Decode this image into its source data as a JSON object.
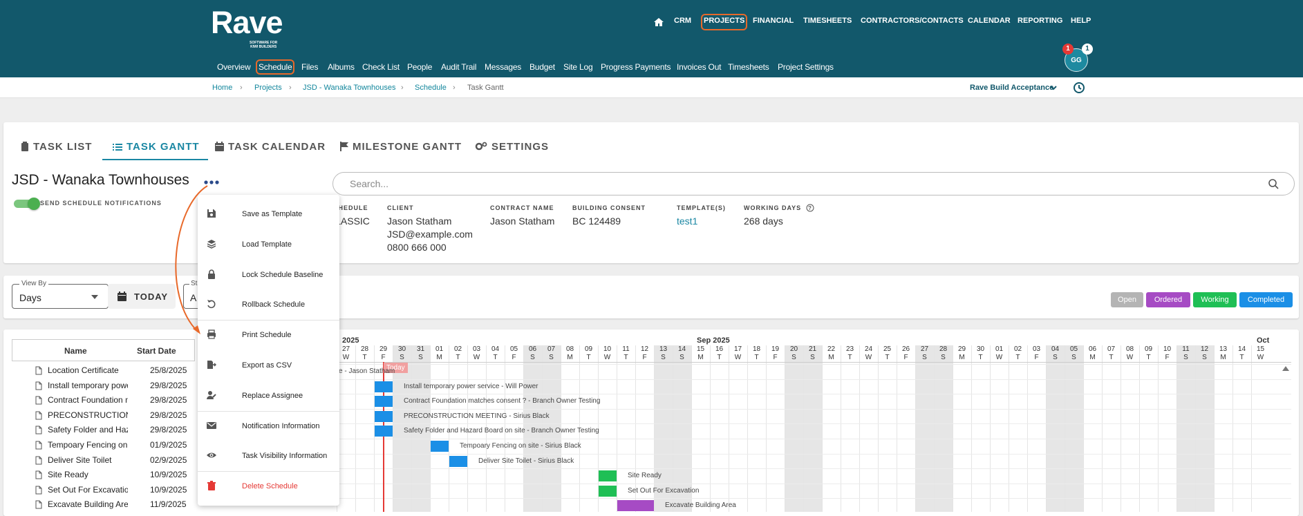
{
  "brand": {
    "name": "Rave",
    "tagline": "SOFTWARE FOR\nKIWI BUILDERS"
  },
  "top_nav": [
    "CRM",
    "PROJECTS",
    "FINANCIAL",
    "TIMESHEETS",
    "CONTRACTORS/CONTACTS",
    "CALENDAR",
    "REPORTING",
    "HELP"
  ],
  "sub_nav": [
    "Overview",
    "Schedule",
    "Files",
    "Albums",
    "Check List",
    "People",
    "Audit Trail",
    "Messages",
    "Budget",
    "Site Log",
    "Progress Payments",
    "Invoices Out",
    "Timesheets",
    "Project Settings"
  ],
  "avatar": {
    "initials": "GG",
    "badge_red": "1",
    "badge_white": "1"
  },
  "breadcrumb": [
    "Home",
    "Projects",
    "JSD - Wanaka Townhouses",
    "Schedule",
    "Task Gantt"
  ],
  "org_selector": "Rave Build Acceptance",
  "tabs": [
    "TASK LIST",
    "TASK GANTT",
    "TASK CALENDAR",
    "MILESTONE GANTT",
    "SETTINGS"
  ],
  "project": {
    "title": "JSD - Wanaka Townhouses",
    "notify_label": "SEND SCHEDULE NOTIFICATIONS",
    "search_placeholder": "Search..."
  },
  "info": {
    "schedule_label": "SCHEDULE",
    "schedule": "CLASSIC",
    "client_label": "CLIENT",
    "client_name": "Jason Statham",
    "client_email": "JSD@example.com",
    "client_phone": "0800 666 000",
    "contract_label": "CONTRACT NAME",
    "contract": "Jason Statham",
    "consent_label": "BUILDING CONSENT",
    "consent": "BC 124489",
    "template_label": "TEMPLATE(S)",
    "template": "test1",
    "wd_label": "WORKING DAYS",
    "wd": "268 days"
  },
  "controls": {
    "view_by_label": "View By",
    "view_by": "Days",
    "today": "TODAY",
    "s_label": "St",
    "s_value": "A"
  },
  "legend": [
    {
      "label": "Open",
      "color": "#b4b4b4"
    },
    {
      "label": "Ordered",
      "color": "#a64bc4"
    },
    {
      "label": "Working",
      "color": "#1fbf55"
    },
    {
      "label": "Completed",
      "color": "#1b8fe6"
    }
  ],
  "grid": {
    "col_name": "Name",
    "col_start": "Start Date",
    "rows": [
      {
        "name": "Location Certificate",
        "start": "25/8/2025"
      },
      {
        "name": "Install temporary power s",
        "start": "29/8/2025"
      },
      {
        "name": "Contract Foundation mate",
        "start": "29/8/2025"
      },
      {
        "name": "PRECONSTRUCTION M",
        "start": "29/8/2025"
      },
      {
        "name": "Safety Folder and Hazarc",
        "start": "29/8/2025"
      },
      {
        "name": "Tempoary Fencing on site",
        "start": "01/9/2025"
      },
      {
        "name": "Deliver Site Toilet",
        "start": "02/9/2025"
      },
      {
        "name": "Site Ready",
        "start": "10/9/2025"
      },
      {
        "name": "Set Out For Excavation",
        "start": "10/9/2025"
      },
      {
        "name": "Excavate Building Area",
        "start": "11/9/2025"
      }
    ]
  },
  "timeline": {
    "months": [
      {
        "label": "2025",
        "day_index": 0
      },
      {
        "label": "Sep 2025",
        "day_index": 19
      },
      {
        "label": "Oct",
        "day_index": 49
      }
    ],
    "days": [
      {
        "d": "27",
        "w": "W"
      },
      {
        "d": "28",
        "w": "T"
      },
      {
        "d": "29",
        "w": "F"
      },
      {
        "d": "30",
        "w": "S"
      },
      {
        "d": "31",
        "w": "S"
      },
      {
        "d": "01",
        "w": "M"
      },
      {
        "d": "02",
        "w": "T"
      },
      {
        "d": "03",
        "w": "W"
      },
      {
        "d": "04",
        "w": "T"
      },
      {
        "d": "05",
        "w": "F"
      },
      {
        "d": "06",
        "w": "S"
      },
      {
        "d": "07",
        "w": "S"
      },
      {
        "d": "08",
        "w": "M"
      },
      {
        "d": "09",
        "w": "T"
      },
      {
        "d": "10",
        "w": "W"
      },
      {
        "d": "11",
        "w": "T"
      },
      {
        "d": "12",
        "w": "F"
      },
      {
        "d": "13",
        "w": "S"
      },
      {
        "d": "14",
        "w": "S"
      },
      {
        "d": "15",
        "w": "M"
      },
      {
        "d": "16",
        "w": "T"
      },
      {
        "d": "17",
        "w": "W"
      },
      {
        "d": "18",
        "w": "T"
      },
      {
        "d": "19",
        "w": "F"
      },
      {
        "d": "20",
        "w": "S"
      },
      {
        "d": "21",
        "w": "S"
      },
      {
        "d": "22",
        "w": "M"
      },
      {
        "d": "23",
        "w": "T"
      },
      {
        "d": "24",
        "w": "W"
      },
      {
        "d": "25",
        "w": "T"
      },
      {
        "d": "26",
        "w": "F"
      },
      {
        "d": "27",
        "w": "S"
      },
      {
        "d": "28",
        "w": "S"
      },
      {
        "d": "29",
        "w": "M"
      },
      {
        "d": "30",
        "w": "T"
      },
      {
        "d": "01",
        "w": "W"
      },
      {
        "d": "02",
        "w": "T"
      },
      {
        "d": "03",
        "w": "F"
      },
      {
        "d": "04",
        "w": "S"
      },
      {
        "d": "05",
        "w": "S"
      },
      {
        "d": "06",
        "w": "M"
      },
      {
        "d": "07",
        "w": "T"
      },
      {
        "d": "08",
        "w": "W"
      },
      {
        "d": "09",
        "w": "T"
      },
      {
        "d": "10",
        "w": "F"
      },
      {
        "d": "11",
        "w": "S"
      },
      {
        "d": "12",
        "w": "S"
      },
      {
        "d": "13",
        "w": "M"
      },
      {
        "d": "14",
        "w": "T"
      },
      {
        "d": "15",
        "w": "W"
      }
    ],
    "today_label": "Today",
    "today_index": 2,
    "bars": [
      {
        "label": "Location Certificate - Jason Statham",
        "start": -4,
        "len": 1,
        "color": "#1b8fe6"
      },
      {
        "label": "Install temporary power service - Will Power",
        "start": 2,
        "len": 1,
        "color": "#1b8fe6"
      },
      {
        "label": "Contract Foundation matches consent ? - Branch Owner Testing",
        "start": 2,
        "len": 1,
        "color": "#1b8fe6"
      },
      {
        "label": "PRECONSTRUCTION MEETING - Sirius Black",
        "start": 2,
        "len": 1,
        "color": "#1b8fe6"
      },
      {
        "label": "Safety Folder and Hazard Board on site - Branch Owner Testing",
        "start": 2,
        "len": 1,
        "color": "#1b8fe6"
      },
      {
        "label": "Tempoary Fencing on site - Sirius Black",
        "start": 5,
        "len": 1,
        "color": "#1b8fe6"
      },
      {
        "label": "Deliver Site Toilet - Sirius Black",
        "start": 6,
        "len": 1,
        "color": "#1b8fe6"
      },
      {
        "label": "Site Ready",
        "start": 14,
        "len": 1,
        "color": "#1fbf55"
      },
      {
        "label": "Set Out For Excavation",
        "start": 14,
        "len": 1,
        "color": "#1fbf55"
      },
      {
        "label": "Excavate Building Area",
        "start": 15,
        "len": 2,
        "color": "#a64bc4"
      }
    ]
  },
  "menu": [
    {
      "label": "Save as Template",
      "icon": "save-icon"
    },
    {
      "label": "Load Template",
      "icon": "layers-icon"
    },
    {
      "label": "Lock Schedule Baseline",
      "icon": "lock-icon"
    },
    {
      "label": "Rollback Schedule",
      "icon": "rollback-icon"
    },
    {
      "label": "Print Schedule",
      "icon": "print-icon"
    },
    {
      "label": "Export as CSV",
      "icon": "export-icon"
    },
    {
      "label": "Replace Assignee",
      "icon": "replace-assignee-icon"
    },
    {
      "label": "Notification Information",
      "icon": "mail-icon"
    },
    {
      "label": "Task Visibility Information",
      "icon": "eye-icon"
    },
    {
      "label": "Delete Schedule",
      "icon": "trash-icon"
    }
  ]
}
